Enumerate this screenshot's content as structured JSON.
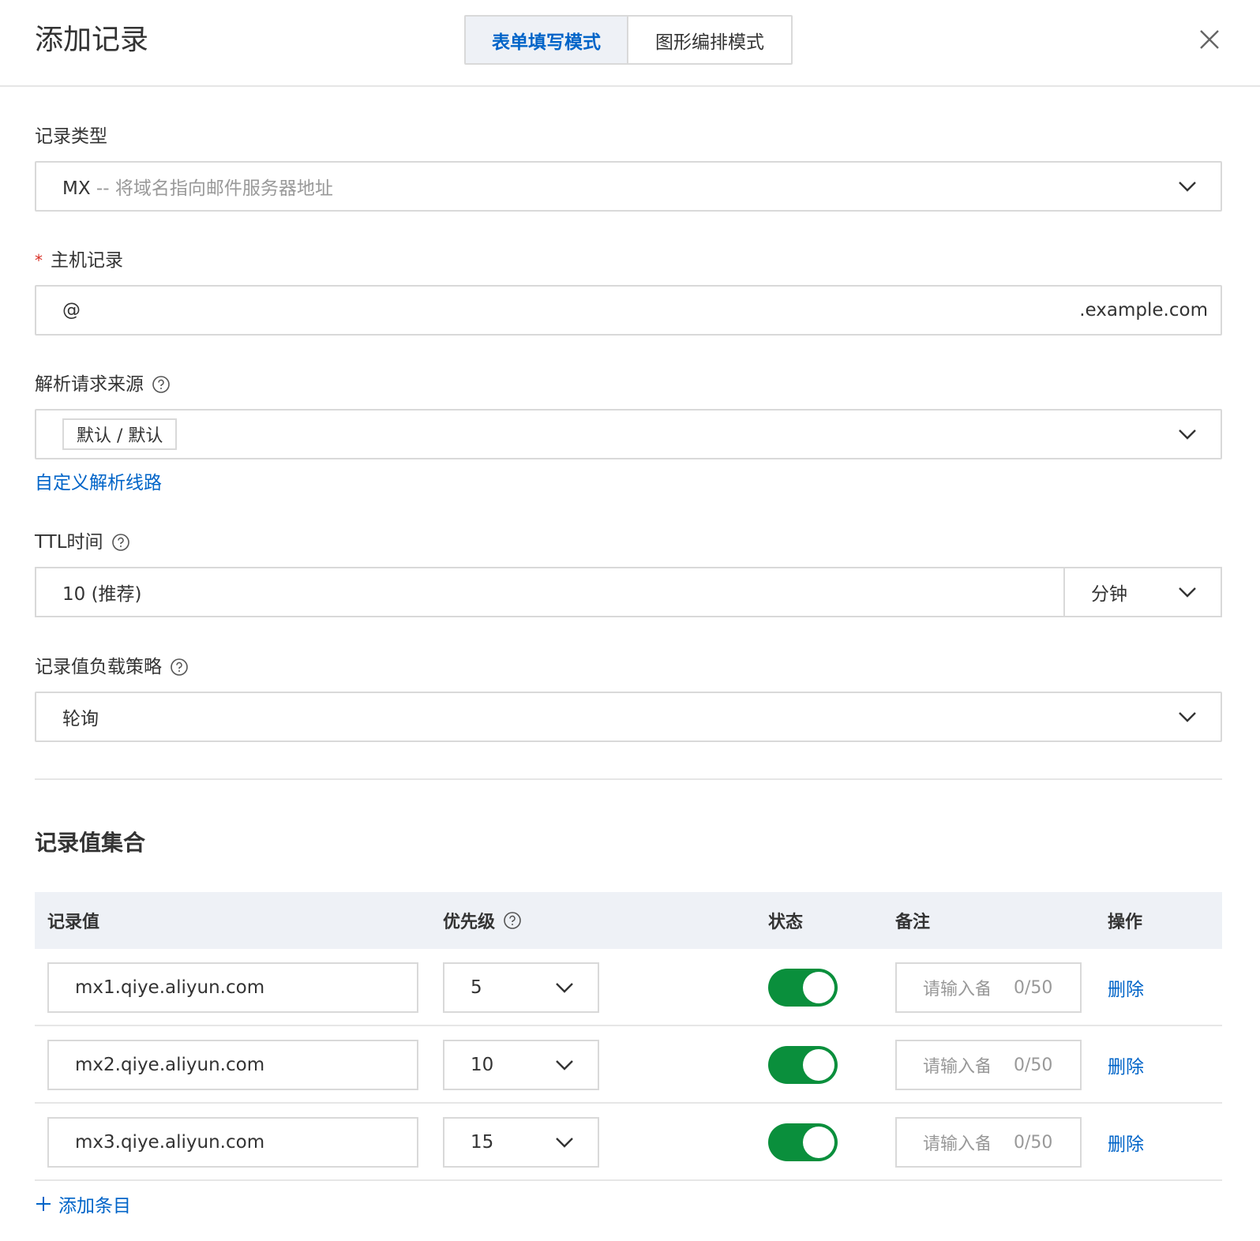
{
  "header": {
    "title": "添加记录",
    "tabs": [
      {
        "label": "表单填写模式",
        "active": true
      },
      {
        "label": "图形编排模式",
        "active": false
      }
    ],
    "close_icon": "close-icon"
  },
  "form": {
    "record_type": {
      "label": "记录类型",
      "value_main": "MX",
      "value_desc": " -- 将域名指向邮件服务器地址"
    },
    "host_record": {
      "required_mark": "*",
      "label": "主机记录",
      "value": "@",
      "suffix": ".example.com"
    },
    "resolve_source": {
      "label": "解析请求来源",
      "tag": "默认 / 默认",
      "link": "自定义解析线路"
    },
    "ttl": {
      "label": "TTL时间",
      "value": "10 (推荐)",
      "unit": "分钟"
    },
    "load_strategy": {
      "label": "记录值负载策略",
      "value": "轮询"
    }
  },
  "records": {
    "title": "记录值集合",
    "columns": [
      "记录值",
      "优先级",
      "状态",
      "备注",
      "操作"
    ],
    "rows": [
      {
        "value": "mx1.qiye.aliyun.com",
        "priority": "5",
        "enabled": true,
        "note_placeholder": "请输入备注",
        "note_count": "0/50",
        "action": "删除"
      },
      {
        "value": "mx2.qiye.aliyun.com",
        "priority": "10",
        "enabled": true,
        "note_placeholder": "请输入备注",
        "note_count": "0/50",
        "action": "删除"
      },
      {
        "value": "mx3.qiye.aliyun.com",
        "priority": "15",
        "enabled": true,
        "note_placeholder": "请输入备注",
        "note_count": "0/50",
        "action": "删除"
      }
    ],
    "add_label": "添加条目"
  },
  "colors": {
    "accent": "#0064c8",
    "toggle_on": "#0a8f3c",
    "required": "#d93026"
  }
}
